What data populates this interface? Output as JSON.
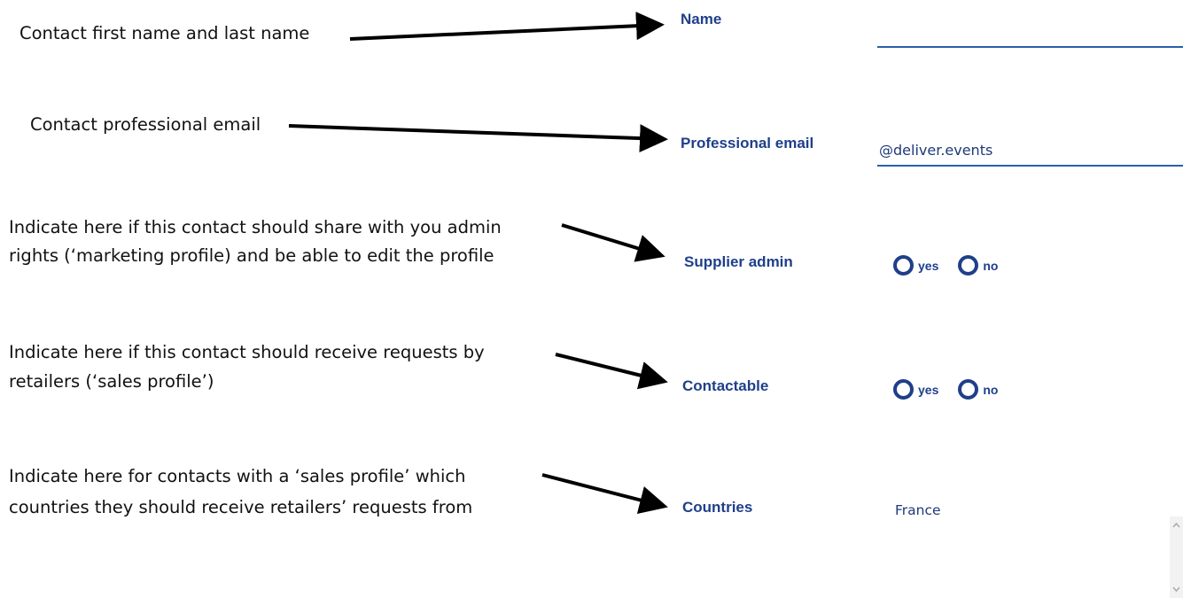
{
  "annotations": {
    "name": [
      "Contact first name and last name"
    ],
    "email": [
      "Contact professional email"
    ],
    "admin": [
      "Indicate here if this contact should share with you admin",
      "rights (‘marketing profile) and be able to edit the profile"
    ],
    "contactable": [
      "Indicate here if this contact should receive requests by",
      "retailers (‘sales profile’)"
    ],
    "countries": [
      "Indicate here for contacts with a ‘sales profile’ which",
      "countries they should receive retailers’ requests from"
    ]
  },
  "form": {
    "name": {
      "label": "Name",
      "value": ""
    },
    "email": {
      "label": "Professional email",
      "value": "@deliver.events"
    },
    "supplier_admin": {
      "label": "Supplier admin",
      "options": [
        "yes",
        "no"
      ]
    },
    "contactable": {
      "label": "Contactable",
      "options": [
        "yes",
        "no"
      ]
    },
    "countries": {
      "label": "Countries",
      "value": "France"
    }
  },
  "colors": {
    "label": "#1f3f8a",
    "field_underline": "#2a5fa8",
    "annotation_text": "#111111",
    "arrow": "#000000"
  }
}
